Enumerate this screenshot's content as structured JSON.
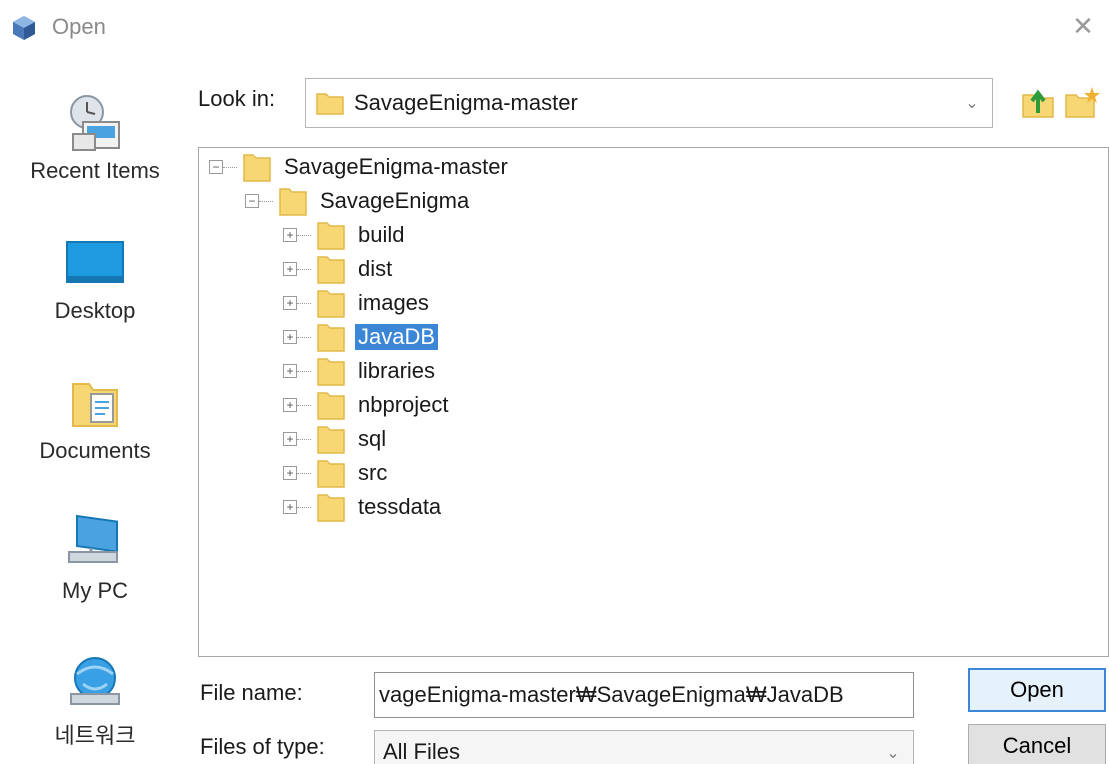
{
  "window": {
    "title": "Open",
    "close_glyph": "✕"
  },
  "places": [
    {
      "label": "Recent Items",
      "icon": "recent-items-icon"
    },
    {
      "label": "Desktop",
      "icon": "desktop-icon"
    },
    {
      "label": "Documents",
      "icon": "documents-icon"
    },
    {
      "label": "My PC",
      "icon": "computer-icon"
    },
    {
      "label": "네트워크",
      "icon": "network-icon"
    }
  ],
  "lookin": {
    "label": "Look in:",
    "value": "SavageEnigma-master"
  },
  "toolbar": {
    "up_icon": "up-folder-icon",
    "new_folder_icon": "new-folder-icon"
  },
  "tree": {
    "root": {
      "label": "SavageEnigma-master",
      "expander": "−"
    },
    "child": {
      "label": "SavageEnigma",
      "expander": "−"
    },
    "items": [
      {
        "label": "build",
        "expander": "+"
      },
      {
        "label": "dist",
        "expander": "+"
      },
      {
        "label": "images",
        "expander": "+"
      },
      {
        "label": "JavaDB",
        "expander": "+",
        "selected": true
      },
      {
        "label": "libraries",
        "expander": "+"
      },
      {
        "label": "nbproject",
        "expander": "+"
      },
      {
        "label": "sql",
        "expander": "+"
      },
      {
        "label": "src",
        "expander": "+"
      },
      {
        "label": "tessdata",
        "expander": "+"
      }
    ]
  },
  "file_name": {
    "label": "File name:",
    "value": "vageEnigma-master₩SavageEnigma₩JavaDB"
  },
  "file_type": {
    "label": "Files of type:",
    "value": "All Files"
  },
  "buttons": {
    "open": "Open",
    "cancel": "Cancel"
  },
  "colors": {
    "selection": "#3b86d6",
    "folder": "#f7d774",
    "folder_edge": "#e2b94a"
  }
}
